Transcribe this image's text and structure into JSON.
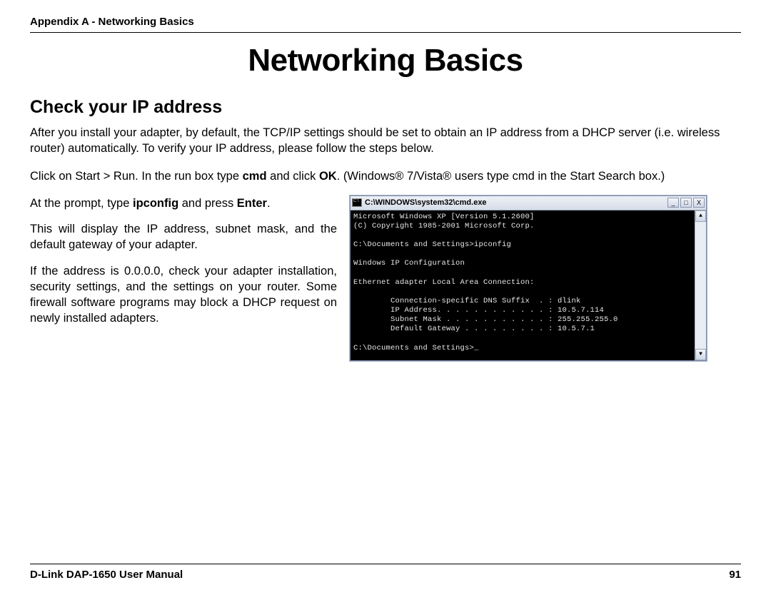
{
  "header": {
    "breadcrumb": "Appendix A - Networking Basics"
  },
  "title": "Networking Basics",
  "section": {
    "heading": "Check your IP address"
  },
  "para": {
    "intro": "After you install your adapter, by default, the TCP/IP settings should be set to obtain an IP address from a DHCP server (i.e. wireless router) automatically. To verify your IP address, please follow the steps below.",
    "run_pre": "Click on Start > Run. In the run box type ",
    "run_bold1": "cmd",
    "run_mid": " and click ",
    "run_bold2": "OK",
    "run_post": ". (Windows® 7/Vista® users type cmd in the Start Search box.)",
    "prompt_pre": "At the prompt, type ",
    "prompt_bold1": "ipconfig",
    "prompt_mid": " and press ",
    "prompt_bold2": "Enter",
    "prompt_post": ".",
    "display": "This will display the IP address, subnet mask, and the default gateway of your adapter.",
    "zero": "If the address is 0.0.0.0, check your adapter installation, security settings, and the settings on your router. Some firewall software programs may block a DHCP request on newly installed adapters."
  },
  "cmd": {
    "title": "C:\\WINDOWS\\system32\\cmd.exe",
    "btn_min": "_",
    "btn_max": "□",
    "btn_close": "X",
    "scroll_up": "▲",
    "scroll_down": "▼",
    "line1": "Microsoft Windows XP [Version 5.1.2600]",
    "line2": "(C) Copyright 1985-2001 Microsoft Corp.",
    "line3": "",
    "line4": "C:\\Documents and Settings>ipconfig",
    "line5": "",
    "line6": "Windows IP Configuration",
    "line7": "",
    "line8": "Ethernet adapter Local Area Connection:",
    "line9": "",
    "line10": "        Connection-specific DNS Suffix  . : dlink",
    "line11": "        IP Address. . . . . . . . . . . . : 10.5.7.114",
    "line12": "        Subnet Mask . . . . . . . . . . . : 255.255.255.0",
    "line13": "        Default Gateway . . . . . . . . . : 10.5.7.1",
    "line14": "",
    "line15": "C:\\Documents and Settings>_"
  },
  "footer": {
    "left": "D-Link DAP-1650 User Manual",
    "page": "91"
  }
}
